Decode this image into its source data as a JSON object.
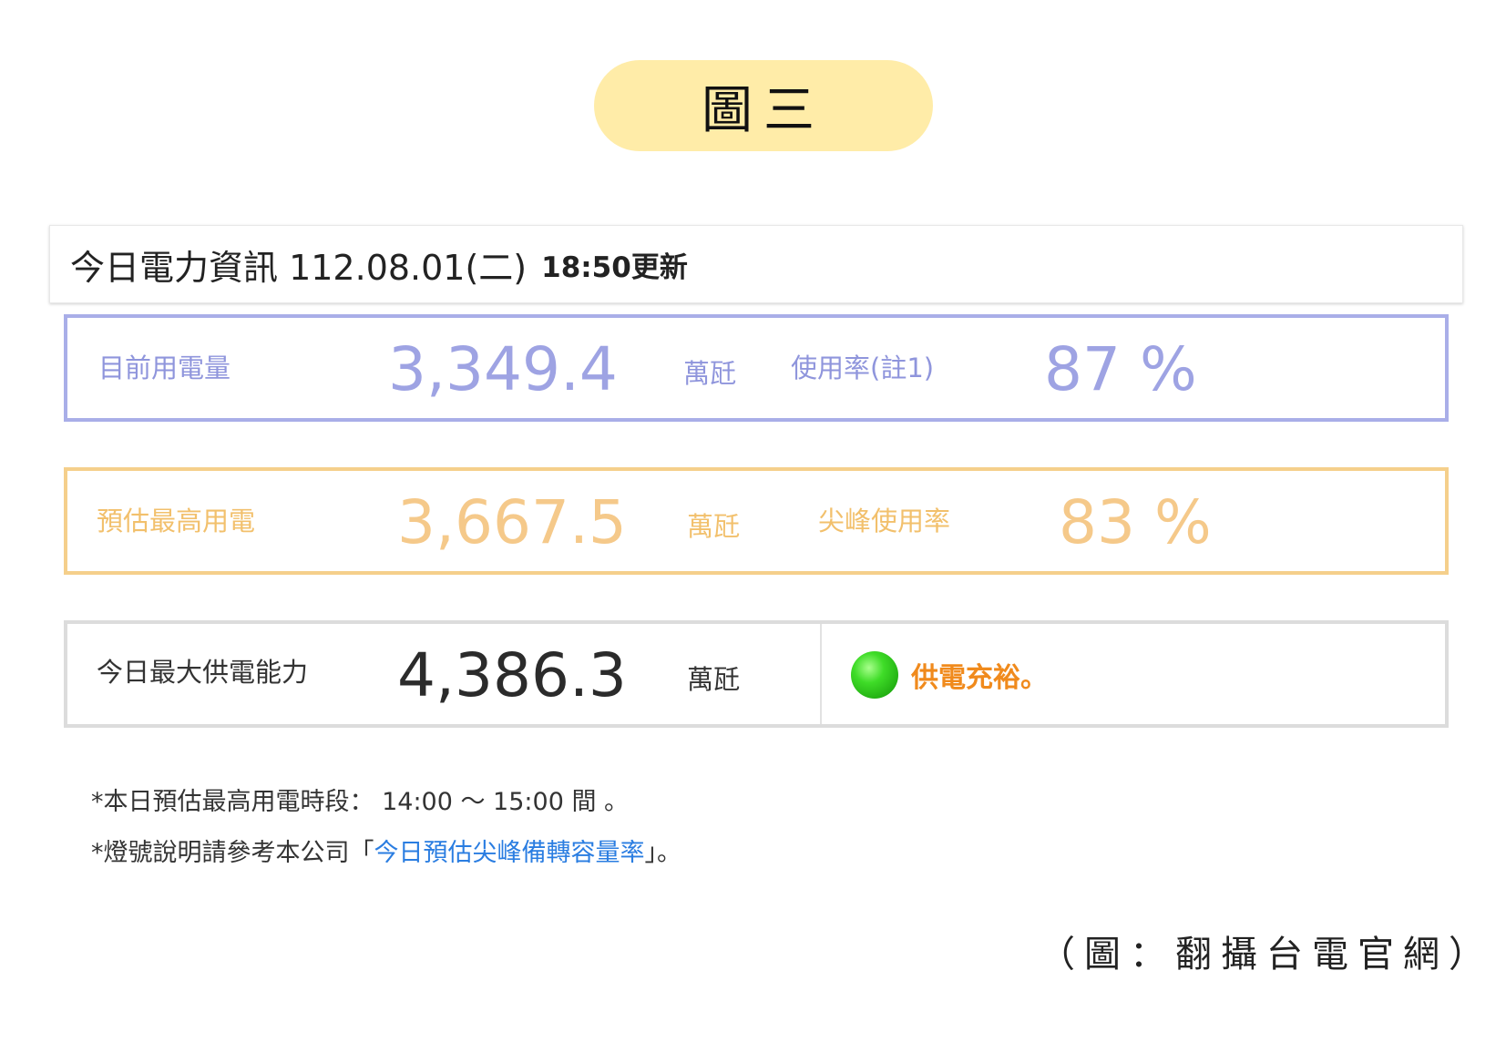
{
  "figure_label": "圖三",
  "header": {
    "title": "今日電力資訊 112.08.01(二)",
    "updated": "18:50更新"
  },
  "current": {
    "label": "目前用電量",
    "value": "3,349.4",
    "unit": "萬瓩",
    "rate_label": "使用率(註1)",
    "rate_value": "87 %"
  },
  "peak": {
    "label": "預估最高用電",
    "value": "3,667.5",
    "unit": "萬瓩",
    "rate_label": "尖峰使用率",
    "rate_value": "83 %"
  },
  "supply": {
    "label": "今日最大供電能力",
    "value": "4,386.3",
    "unit": "萬瓩",
    "status_text": "供電充裕。",
    "status_color": "#3fdc28"
  },
  "notes": {
    "peak_time": "*本日預估最高用電時段： 14:00 ～ 15:00 間 。",
    "light_prefix": "*燈號說明請參考本公司「",
    "light_link": "今日預估尖峰備轉容量率",
    "light_suffix": "」。"
  },
  "credit": "（圖：翻攝台電官網）",
  "colors": {
    "current_border": "#a9aee8",
    "peak_border": "#f5cf8b",
    "supply_border": "#dcdcdc",
    "status_text": "#f08a1c",
    "link": "#2a7de1",
    "pill": "#ffeca8"
  }
}
